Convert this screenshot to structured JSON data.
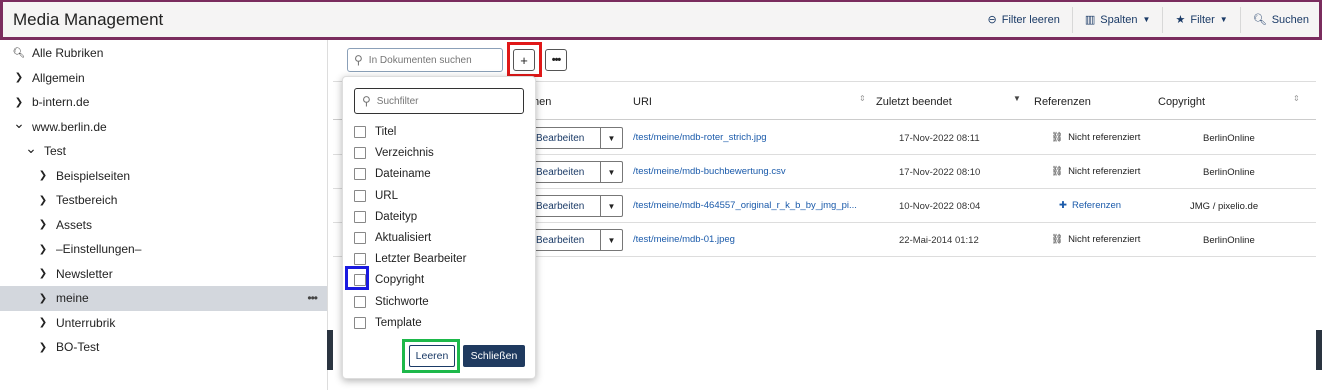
{
  "app": {
    "title": "Media Management"
  },
  "header": {
    "filter_clear": "Filter leeren",
    "columns": "Spalten",
    "filter": "Filter",
    "search": "Suchen"
  },
  "sidebar": {
    "items": [
      {
        "label": "Alle Rubriken",
        "icon": "search-icon",
        "level": 0
      },
      {
        "label": "Allgemein",
        "icon": "chevron-right-icon",
        "level": 0
      },
      {
        "label": "b-intern.de",
        "icon": "chevron-right-icon",
        "level": 0
      },
      {
        "label": "www.berlin.de",
        "icon": "chevron-down-icon",
        "level": 0
      },
      {
        "label": "Test",
        "icon": "chevron-down-icon",
        "level": 1
      },
      {
        "label": "Beispielseiten",
        "icon": "chevron-right-icon",
        "level": 2
      },
      {
        "label": "Testbereich",
        "icon": "chevron-right-icon",
        "level": 2
      },
      {
        "label": "Assets",
        "icon": "chevron-right-icon",
        "level": 2
      },
      {
        "label": "–Einstellungen–",
        "icon": "chevron-right-icon",
        "level": 2
      },
      {
        "label": "Newsletter",
        "icon": "chevron-right-icon",
        "level": 2
      },
      {
        "label": "meine",
        "icon": "chevron-right-icon",
        "level": 2,
        "active": true
      },
      {
        "label": "Unterrubrik",
        "icon": "chevron-right-icon",
        "level": 2
      },
      {
        "label": "BO-Test",
        "icon": "chevron-right-icon",
        "level": 2
      }
    ]
  },
  "toolbar": {
    "search_placeholder": "In Dokumenten suchen",
    "add_label": "+",
    "more_label": "•••"
  },
  "table": {
    "headers": {
      "actions": "nen",
      "uri": "URI",
      "last_finished": "Zuletzt beendet",
      "references": "Referenzen",
      "copyright": "Copyright"
    },
    "rows": [
      {
        "edit": "Bearbeiten",
        "uri": "/test/meine/mdb-roter_strich.jpg",
        "date": "17-Nov-2022 08:11",
        "ref": "Nicht referenziert",
        "copyright": "BerlinOnline"
      },
      {
        "edit": "Bearbeiten",
        "uri": "/test/meine/mdb-buchbewertung.csv",
        "date": "17-Nov-2022 08:10",
        "ref": "Nicht referenziert",
        "copyright": "BerlinOnline"
      },
      {
        "edit": "Bearbeiten",
        "uri": "/test/meine/mdb-464557_original_r_k_b_by_jmg_pi...",
        "date": "10-Nov-2022 08:04",
        "ref": "Referenzen",
        "copyright": "JMG / pixelio.de"
      },
      {
        "edit": "Bearbeiten",
        "uri": "/test/meine/mdb-01.jpeg",
        "date": "22-Mai-2014 01:12",
        "ref": "Nicht referenziert",
        "copyright": "BerlinOnline"
      }
    ]
  },
  "popup": {
    "search_placeholder": "Suchfilter",
    "options": [
      "Titel",
      "Verzeichnis",
      "Dateiname",
      "URL",
      "Dateityp",
      "Aktualisiert",
      "Letzter Bearbeiter",
      "Copyright",
      "Stichworte",
      "Template"
    ],
    "clear_label": "Leeren",
    "close_label": "Schließen"
  },
  "colors": {
    "header_border": "#7a2c5e",
    "highlight_red": "#e01818",
    "highlight_blue": "#1a1ae0",
    "highlight_green": "#1db84a",
    "primary": "#1f3a5f"
  }
}
